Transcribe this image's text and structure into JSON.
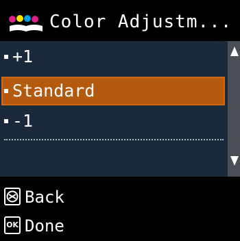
{
  "header": {
    "title": "Color Adjustm...",
    "icon": "color-ink-drops-icon"
  },
  "list": {
    "items": [
      {
        "label": "+1",
        "selected": false
      },
      {
        "label": "Standard",
        "selected": true
      },
      {
        "label": "-1",
        "selected": false
      }
    ]
  },
  "scrollbar": {
    "up_icon": "scroll-up-arrow-icon",
    "down_icon": "scroll-down-arrow-icon"
  },
  "footer": {
    "back_label": "Back",
    "back_icon": "stop-back-icon",
    "done_label": "Done",
    "done_icon_text": "OK"
  },
  "colors": {
    "background": "#000000",
    "list_background": "#1b2a3a",
    "selected_background": "#b35a0e",
    "scrollbar": "#4a4f56",
    "text": "#ffffff"
  }
}
